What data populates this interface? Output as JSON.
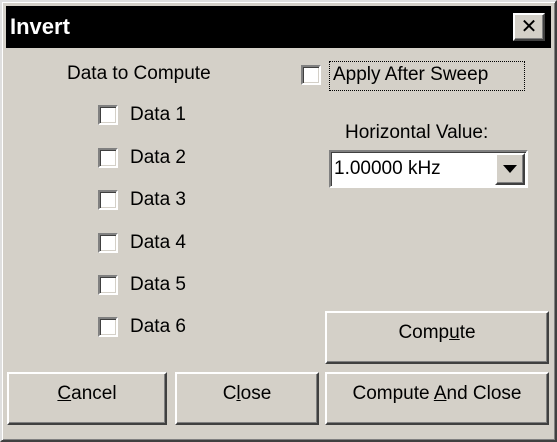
{
  "window": {
    "title": "Invert",
    "close_glyph": "✕"
  },
  "data_group": {
    "heading": "Data to Compute",
    "items": [
      {
        "label": "Data 1",
        "checked": false
      },
      {
        "label": "Data 2",
        "checked": false
      },
      {
        "label": "Data 3",
        "checked": false
      },
      {
        "label": "Data 4",
        "checked": false
      },
      {
        "label": "Data 5",
        "checked": false
      },
      {
        "label": "Data 6",
        "checked": false
      }
    ]
  },
  "apply_after_sweep": {
    "label": "Apply After Sweep",
    "checked": false
  },
  "horizontal": {
    "label": "Horizontal Value:",
    "value": "1.00000 kHz"
  },
  "buttons": {
    "compute": {
      "pre": "Comp",
      "mnemonic": "u",
      "post": "te"
    },
    "cancel": {
      "pre": "",
      "mnemonic": "C",
      "post": "ancel"
    },
    "close": {
      "pre": "C",
      "mnemonic": "l",
      "post": "ose"
    },
    "compute_and_close": {
      "pre": "Compute ",
      "mnemonic": "A",
      "post": "nd Close"
    }
  },
  "colors": {
    "face": "#d4d0c8",
    "titlebar": "#000000",
    "title_text": "#ffffff"
  }
}
